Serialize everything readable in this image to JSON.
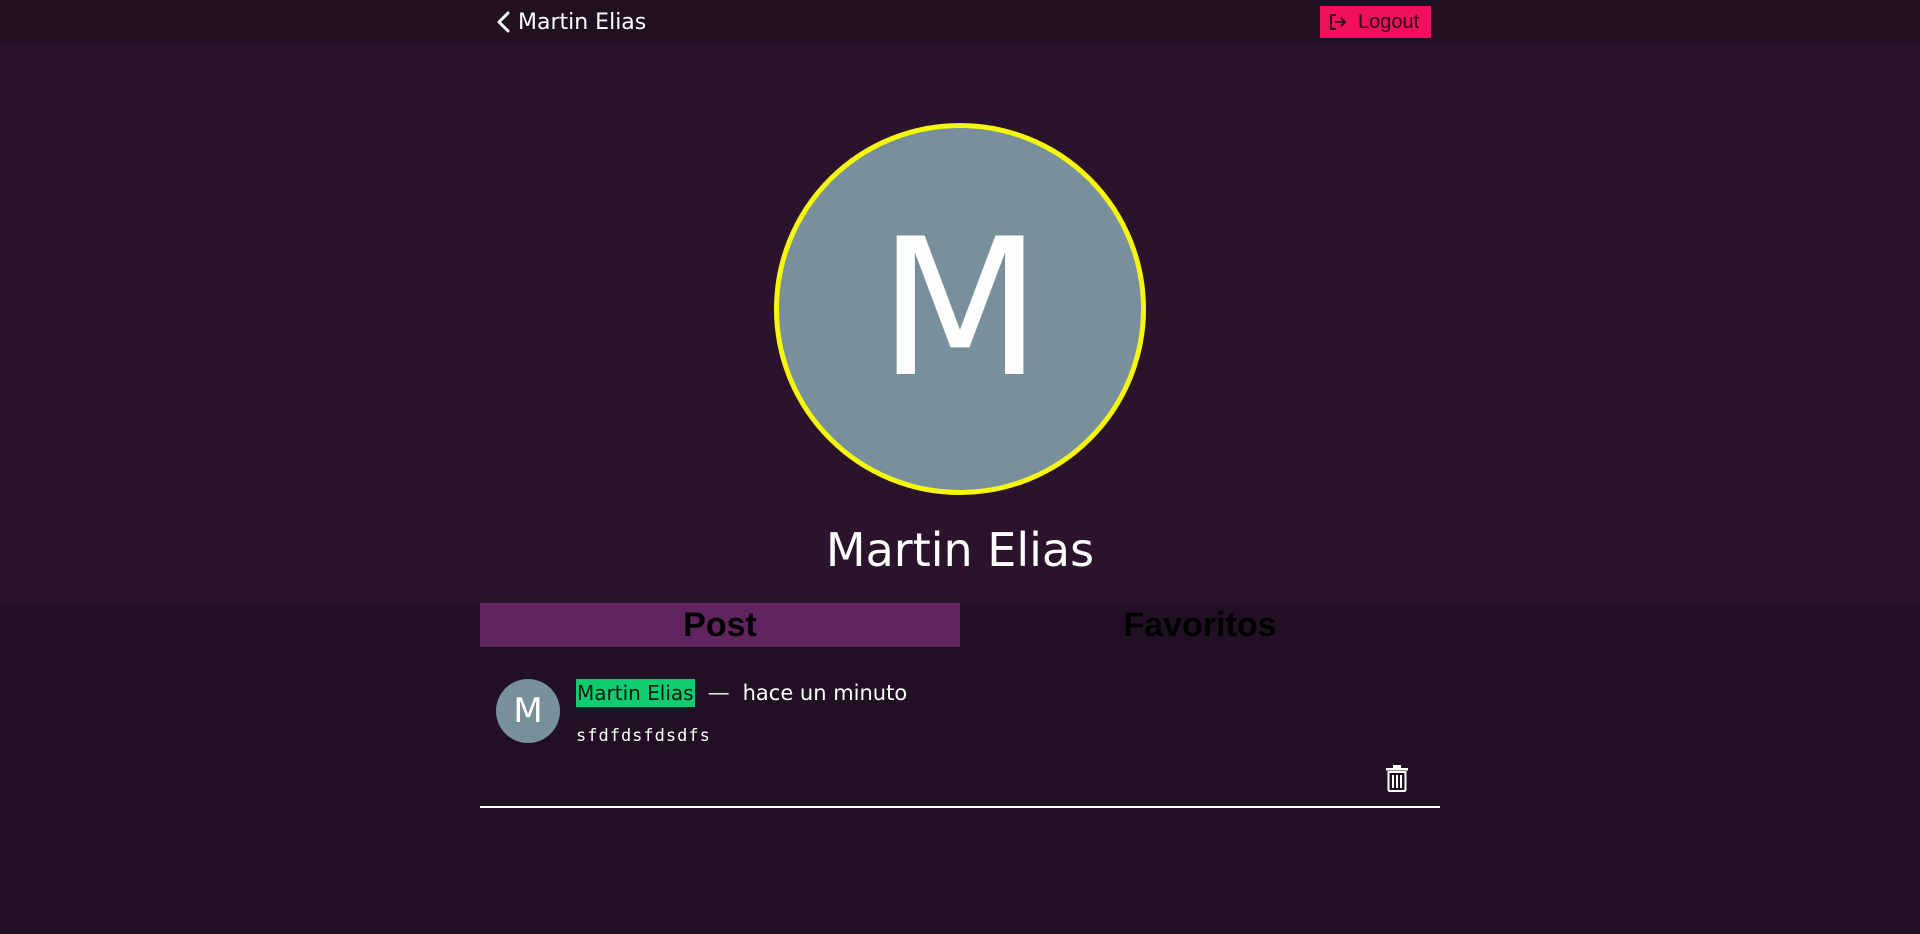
{
  "header": {
    "back_label": "Martin Elias",
    "logout_label": "Logout",
    "logout_color": "#f0105e"
  },
  "profile": {
    "avatar_initial": "M",
    "name": "Martin Elias",
    "avatar_bg": "#78909b",
    "avatar_border": "#f7f70e"
  },
  "tabs": [
    {
      "label": "Post",
      "active": true
    },
    {
      "label": "Favoritos",
      "active": false
    }
  ],
  "posts": [
    {
      "avatar_initial": "M",
      "author": "Martin Elias",
      "separator": "—",
      "time": "hace un minuto",
      "body": "sfdfdsfdsdfs",
      "delete_icon": "trash-icon"
    }
  ],
  "icons": {
    "back": "chevron-left-icon",
    "logout": "logout-icon"
  }
}
